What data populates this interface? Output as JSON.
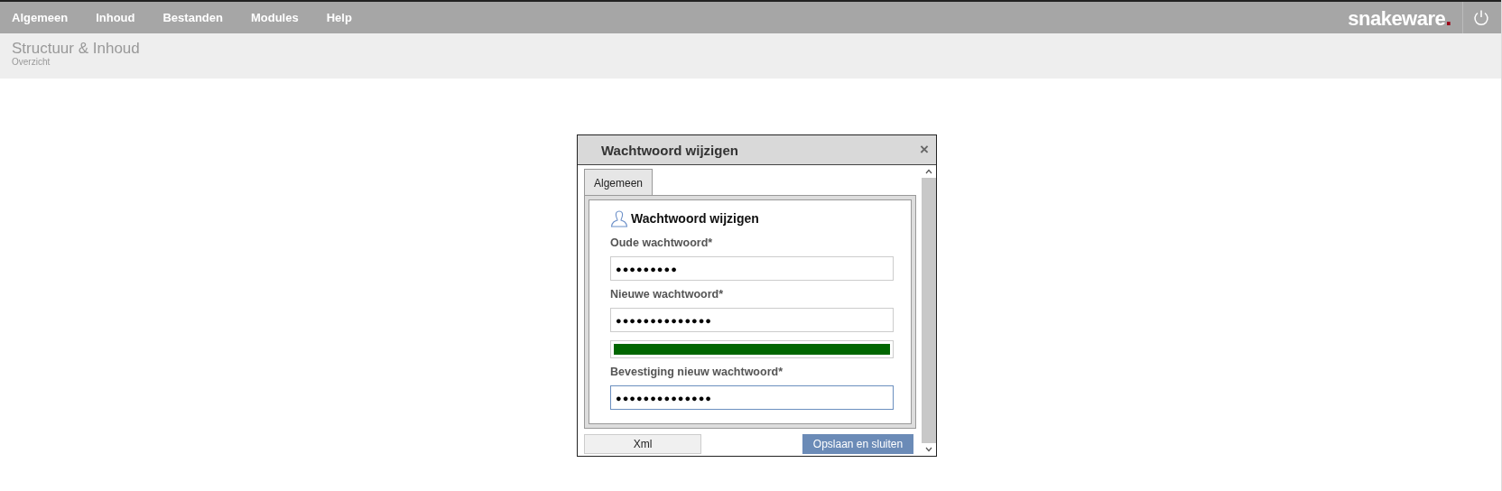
{
  "menu": [
    {
      "label": "Algemeen"
    },
    {
      "label": "Inhoud"
    },
    {
      "label": "Bestanden"
    },
    {
      "label": "Modules"
    },
    {
      "label": "Help"
    }
  ],
  "logo": {
    "name": "snakeware",
    "dot": "."
  },
  "header": {
    "title": "Structuur & Inhoud",
    "subtitle": "Overzicht"
  },
  "dialog": {
    "title": "Wachtwoord wijzigen",
    "close": "×",
    "tabs": [
      {
        "label": "Algemeen",
        "selected": true
      }
    ],
    "section_title": "Wachtwoord wijzigen",
    "fields": [
      {
        "kind": "password",
        "label": "Oude wachtwoord*",
        "value": "●●●●●●●●●",
        "focused": false
      },
      {
        "kind": "password",
        "label": "Nieuwe wachtwoord*",
        "value": "●●●●●●●●●●●●●●",
        "focused": false
      },
      {
        "kind": "meter",
        "level": 1,
        "color": "#006600"
      },
      {
        "kind": "password",
        "label": "Bevestiging nieuw wachtwoord*",
        "value": "●●●●●●●●●●●●●●",
        "focused": true
      }
    ],
    "buttons": [
      {
        "label": "Xml",
        "kind": "secondary"
      },
      {
        "label": "Opslaan en sluiten",
        "kind": "primary"
      }
    ]
  }
}
